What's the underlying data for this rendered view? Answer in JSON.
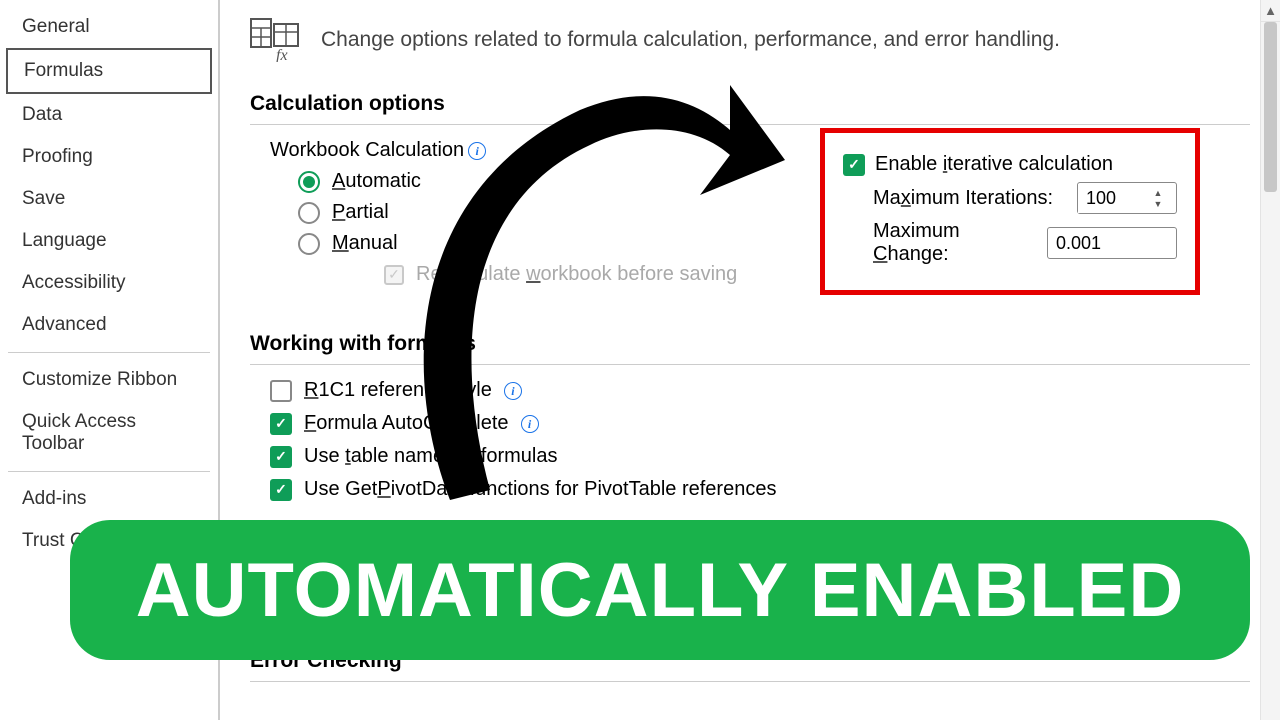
{
  "sidebar": {
    "items": [
      "General",
      "Formulas",
      "Data",
      "Proofing",
      "Save",
      "Language",
      "Accessibility",
      "Advanced"
    ],
    "active": "Formulas",
    "group2": [
      "Customize Ribbon",
      "Quick Access Toolbar"
    ],
    "group3": [
      "Add-ins",
      "Trust Center"
    ]
  },
  "header": {
    "text": "Change options related to formula calculation, performance, and error handling."
  },
  "sections": {
    "calc": {
      "title": "Calculation options",
      "label": "Workbook Calculation",
      "radios": {
        "automatic": {
          "u": "A",
          "rest": "utomatic"
        },
        "partial": {
          "u": "P",
          "rest": "artial"
        },
        "manual": {
          "u": "M",
          "rest": "anual"
        }
      },
      "recalc": {
        "pre": "Recalculate ",
        "u": "w",
        "post": "orkbook before saving"
      }
    },
    "iter": {
      "enable": {
        "pre": "Enable ",
        "u": "i",
        "post": "terative calculation"
      },
      "maxIter": {
        "pre": "Ma",
        "u": "x",
        "post": "imum Iterations:",
        "value": "100"
      },
      "maxChange": {
        "pre": "Maximum ",
        "u": "C",
        "post": "hange:",
        "value": "0.001"
      }
    },
    "working": {
      "title": "Working with formulas",
      "r1c1": {
        "u": "R",
        "rest": "1C1 reference style"
      },
      "auto": {
        "u": "F",
        "rest": "ormula AutoComplete"
      },
      "table": {
        "pre": "Use ",
        "u": "t",
        "post": "able names in formulas"
      },
      "pivot": {
        "pre": "Use Get",
        "u": "P",
        "post": "ivotData functions for PivotTable references"
      }
    },
    "error": {
      "title": "Error Checking"
    }
  },
  "banner": {
    "text": "AUTOMATICALLY ENABLED"
  }
}
